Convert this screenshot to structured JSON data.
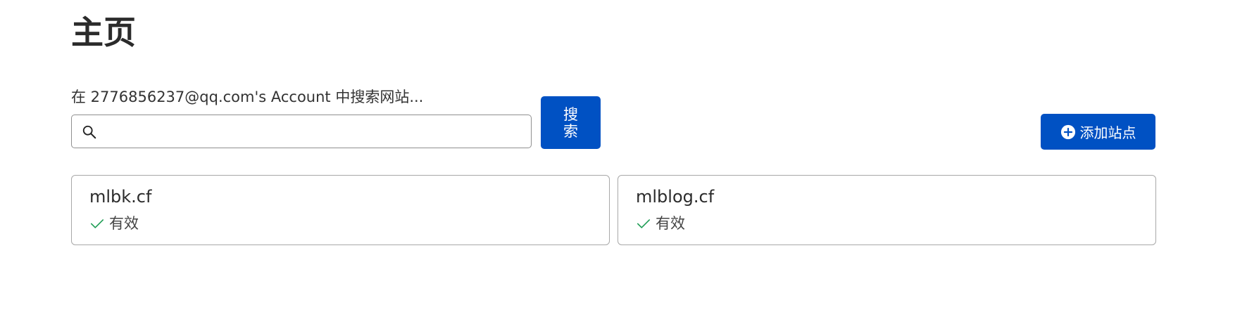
{
  "page": {
    "title": "主页"
  },
  "search": {
    "label": "在 2776856237@qq.com's Account 中搜索网站...",
    "value": "",
    "placeholder": "",
    "icon": "search-icon",
    "button_label": "搜索"
  },
  "actions": {
    "add_site_label": "添加站点",
    "add_site_icon": "plus-circle-icon"
  },
  "sites": [
    {
      "name": "mlbk.cf",
      "status": "有效",
      "status_icon": "check-icon"
    },
    {
      "name": "mlblog.cf",
      "status": "有效",
      "status_icon": "check-icon"
    }
  ],
  "colors": {
    "primary": "#0051c3",
    "status_ok": "#1f9d55",
    "border": "#a8a8a8"
  }
}
